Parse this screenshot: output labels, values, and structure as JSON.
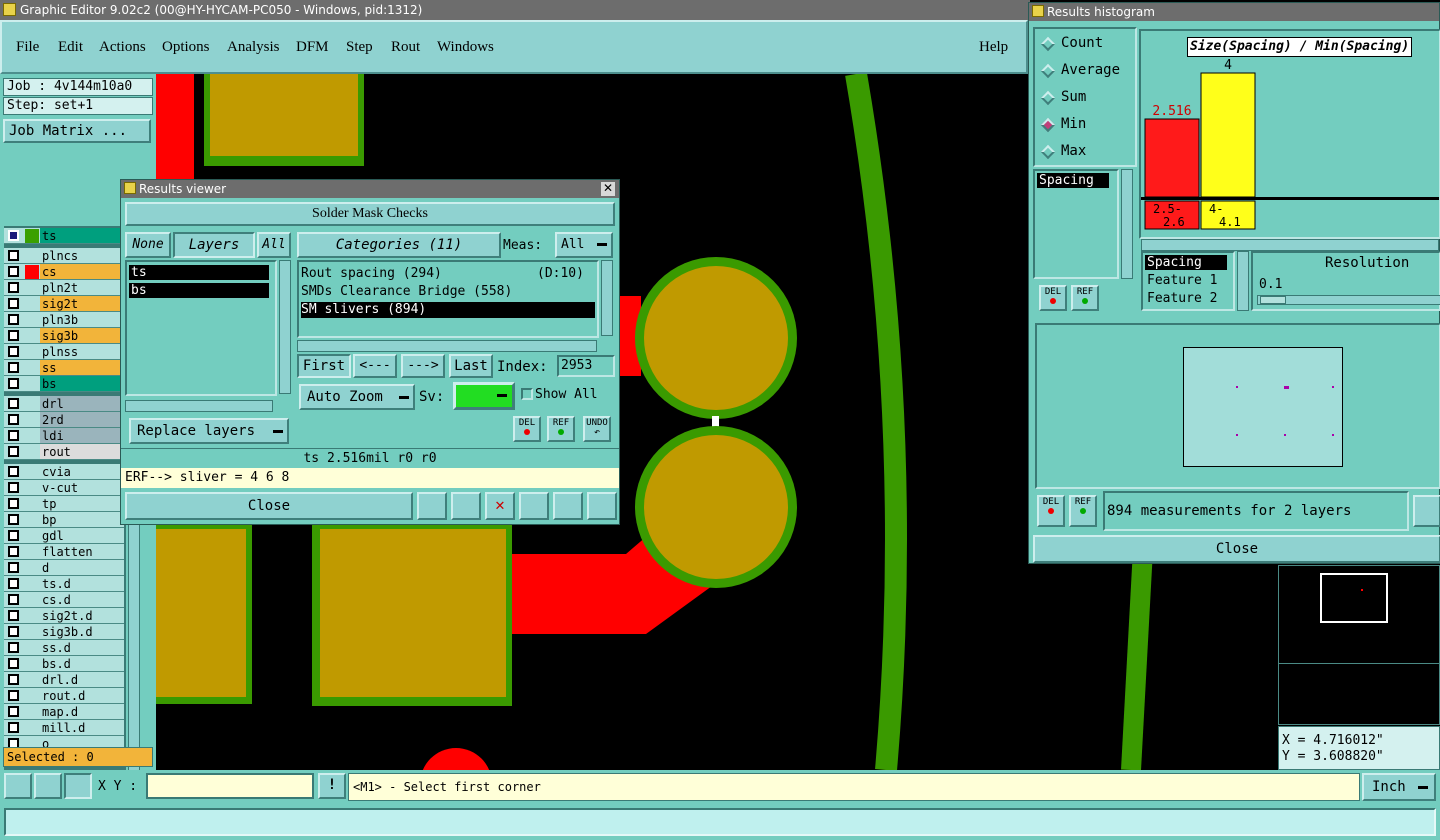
{
  "window_title": "Graphic Editor 9.02c2 (00@HY-HYCAM-PC050 - Windows, pid:1312)",
  "menu": [
    "File",
    "Edit",
    "Actions",
    "Options",
    "Analysis",
    "DFM",
    "Step",
    "Rout",
    "Windows"
  ],
  "help": "Help",
  "job": "Job : 4v144m10a0",
  "step": "Step: set+1",
  "job_matrix": "Job Matrix ...",
  "layers": [
    {
      "name": "ts",
      "color": "#009f7e"
    },
    {
      "name": "plncs",
      "color": ""
    },
    {
      "name": "cs",
      "color": "#f2b43a"
    },
    {
      "name": "pln2t",
      "color": ""
    },
    {
      "name": "sig2t",
      "color": "#f2b43a"
    },
    {
      "name": "pln3b",
      "color": ""
    },
    {
      "name": "sig3b",
      "color": "#f2b43a"
    },
    {
      "name": "plnss",
      "color": ""
    },
    {
      "name": "ss",
      "color": "#f2b43a"
    },
    {
      "name": "bs",
      "color": "#009f7e"
    },
    {
      "name": "drl",
      "color": "#9ab4bc"
    },
    {
      "name": "2rd",
      "color": "#9ab4bc"
    },
    {
      "name": "ldi",
      "color": "#9ab4bc"
    },
    {
      "name": "rout",
      "color": "#dcdcdc"
    },
    {
      "name": "cvia",
      "color": ""
    },
    {
      "name": "v-cut",
      "color": ""
    },
    {
      "name": "tp",
      "color": ""
    },
    {
      "name": "bp",
      "color": ""
    },
    {
      "name": "gdl",
      "color": ""
    },
    {
      "name": "flatten",
      "color": ""
    },
    {
      "name": "d",
      "color": ""
    },
    {
      "name": "ts.d",
      "color": ""
    },
    {
      "name": "cs.d",
      "color": ""
    },
    {
      "name": "sig2t.d",
      "color": ""
    },
    {
      "name": "sig3b.d",
      "color": ""
    },
    {
      "name": "ss.d",
      "color": ""
    },
    {
      "name": "bs.d",
      "color": ""
    },
    {
      "name": "drl.d",
      "color": ""
    },
    {
      "name": "rout.d",
      "color": ""
    },
    {
      "name": "map.d",
      "color": ""
    },
    {
      "name": "mill.d",
      "color": ""
    },
    {
      "name": "o",
      "color": ""
    }
  ],
  "selected": "Selected : 0",
  "results_viewer": {
    "title": "Results viewer",
    "header": "Solder Mask Checks",
    "none_btn": "None",
    "layers_btn": "Layers",
    "all_btn": "All",
    "categories_btn": "Categories (11)",
    "meas_label": "Meas:",
    "meas_value": "All",
    "layer_items": [
      "ts",
      "bs"
    ],
    "categories": [
      {
        "name": "Rout spacing (294)",
        "extra": "(D:10)"
      },
      {
        "name": "SMDs Clearance Bridge (558)",
        "extra": ""
      },
      {
        "name": "SM slivers (894)",
        "extra": ""
      }
    ],
    "first": "First",
    "prev": "<---",
    "next": "--->",
    "last": "Last",
    "index_label": "Index:",
    "index_value": "2953",
    "auto_zoom": "Auto Zoom",
    "sv_label": "Sv:",
    "show_all": "Show All",
    "replace_layers": "Replace layers",
    "del": "DEL",
    "ref": "REF",
    "undo": "UNDO",
    "info_line": "ts 2.516mil   r0   r0",
    "erf_line": "ERF--> sliver = 4 6 8",
    "close": "Close"
  },
  "histogram": {
    "title": "Results histogram",
    "modes": [
      "Count",
      "Average",
      "Sum",
      "Min",
      "Max"
    ],
    "selected_mode": "Min",
    "field": "Spacing",
    "chart_title": "Size(Spacing) / Min(Spacing)",
    "resolution_label": "Resolution",
    "resolution_value": "0.1",
    "attrs": [
      "Spacing",
      "Feature 1",
      "Feature 2"
    ],
    "status": "894 measurements for 2 layers",
    "close": "Close",
    "del": "DEL",
    "ref": "REF"
  },
  "chart_data": {
    "type": "bar",
    "title": "Size(Spacing) / Min(Spacing)",
    "categories": [
      "2.5-2.6",
      "4-4.1"
    ],
    "values": [
      2.516,
      4
    ],
    "value_labels": [
      "2.516",
      "4"
    ],
    "colors": [
      "#ff1a1a",
      "#ffff1a"
    ]
  },
  "coords": {
    "x": "X = 4.716012\"",
    "y": "Y = 3.608820\""
  },
  "xy_label": "X Y :",
  "prompt": "<M1> - Select first corner",
  "units": "Inch"
}
